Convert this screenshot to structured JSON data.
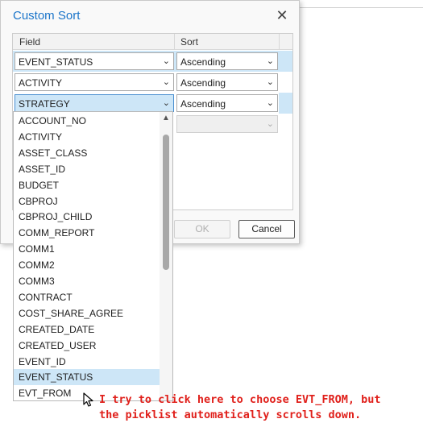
{
  "dialog": {
    "title": "Custom Sort",
    "close_glyph": "✕"
  },
  "grid": {
    "columns": [
      "Field",
      "Sort"
    ],
    "rows": [
      {
        "field": "EVENT_STATUS",
        "sort": "Ascending"
      },
      {
        "field": "ACTIVITY",
        "sort": "Ascending"
      },
      {
        "field": "STRATEGY",
        "sort": "Ascending"
      },
      {
        "field": "",
        "sort": ""
      }
    ]
  },
  "buttons": {
    "ok_label": "OK",
    "cancel_label": "Cancel"
  },
  "dropdown": {
    "items": [
      "ACCOUNT_NO",
      "ACTIVITY",
      "ASSET_CLASS",
      "ASSET_ID",
      "BUDGET",
      "CBPROJ",
      "CBPROJ_CHILD",
      "COMM_REPORT",
      "COMM1",
      "COMM2",
      "COMM3",
      "CONTRACT",
      "COST_SHARE_AGREE",
      "CREATED_DATE",
      "CREATED_USER",
      "EVENT_ID",
      "EVENT_STATUS",
      "EVT_FROM"
    ],
    "highlighted": "EVENT_STATUS"
  },
  "annotation": {
    "line1": "I try to click here to choose EVT_FROM, but",
    "line2": "the picklist automatically scrolls down."
  },
  "icons": {
    "chevron": "chevron-down-icon",
    "close": "close-icon",
    "cursor": "mouse-pointer-icon"
  },
  "colors": {
    "title": "#1a74c9",
    "selection": "#cde6f7",
    "annotation": "#e0201b"
  }
}
